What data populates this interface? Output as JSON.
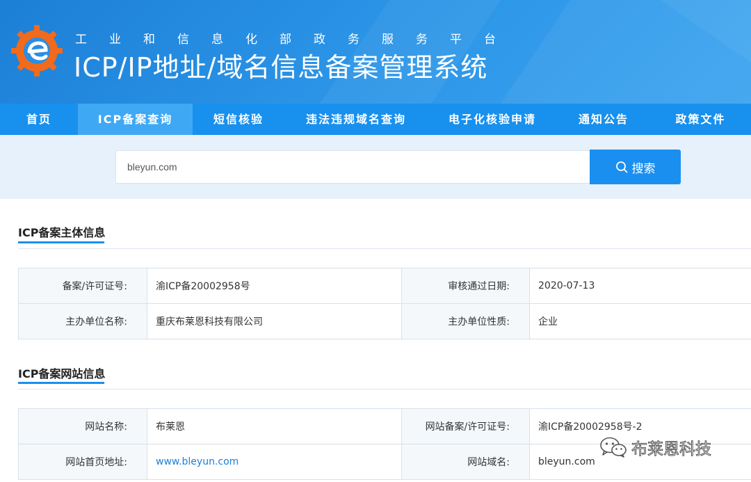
{
  "header": {
    "subtitle": "工业和信息化部政务服务平台",
    "title": "ICP/IP地址/域名信息备案管理系统"
  },
  "nav": {
    "items": [
      {
        "label": "首页",
        "active": false
      },
      {
        "label": "ICP备案查询",
        "active": true
      },
      {
        "label": "短信核验",
        "active": false
      },
      {
        "label": "违法违规域名查询",
        "active": false
      },
      {
        "label": "电子化核验申请",
        "active": false
      },
      {
        "label": "通知公告",
        "active": false
      },
      {
        "label": "政策文件",
        "active": false
      }
    ]
  },
  "search": {
    "value": "bleyun.com",
    "button_label": "搜索"
  },
  "subject_section": {
    "title": "ICP备案主体信息",
    "rows": [
      [
        {
          "label": "备案/许可证号:",
          "value": "渝ICP备20002958号"
        },
        {
          "label": "审核通过日期:",
          "value": "2020-07-13"
        }
      ],
      [
        {
          "label": "主办单位名称:",
          "value": "重庆布莱恩科技有限公司"
        },
        {
          "label": "主办单位性质:",
          "value": "企业"
        }
      ]
    ]
  },
  "website_section": {
    "title": "ICP备案网站信息",
    "rows": [
      [
        {
          "label": "网站名称:",
          "value": "布莱恩"
        },
        {
          "label": "网站备案/许可证号:",
          "value": "渝ICP备20002958号-2"
        }
      ],
      [
        {
          "label": "网站首页地址:",
          "value": "www.bleyun.com",
          "link": true
        },
        {
          "label": "网站域名:",
          "value": "bleyun.com"
        }
      ]
    ]
  },
  "watermark": {
    "text": "布莱恩科技",
    "icon": "wechat-icon"
  },
  "colors": {
    "header_blue": "#2a93e6",
    "nav_blue": "#1890ee",
    "nav_active": "#3fa8f5",
    "accent": "#1a8ff0",
    "logo_orange": "#f26a1b"
  }
}
